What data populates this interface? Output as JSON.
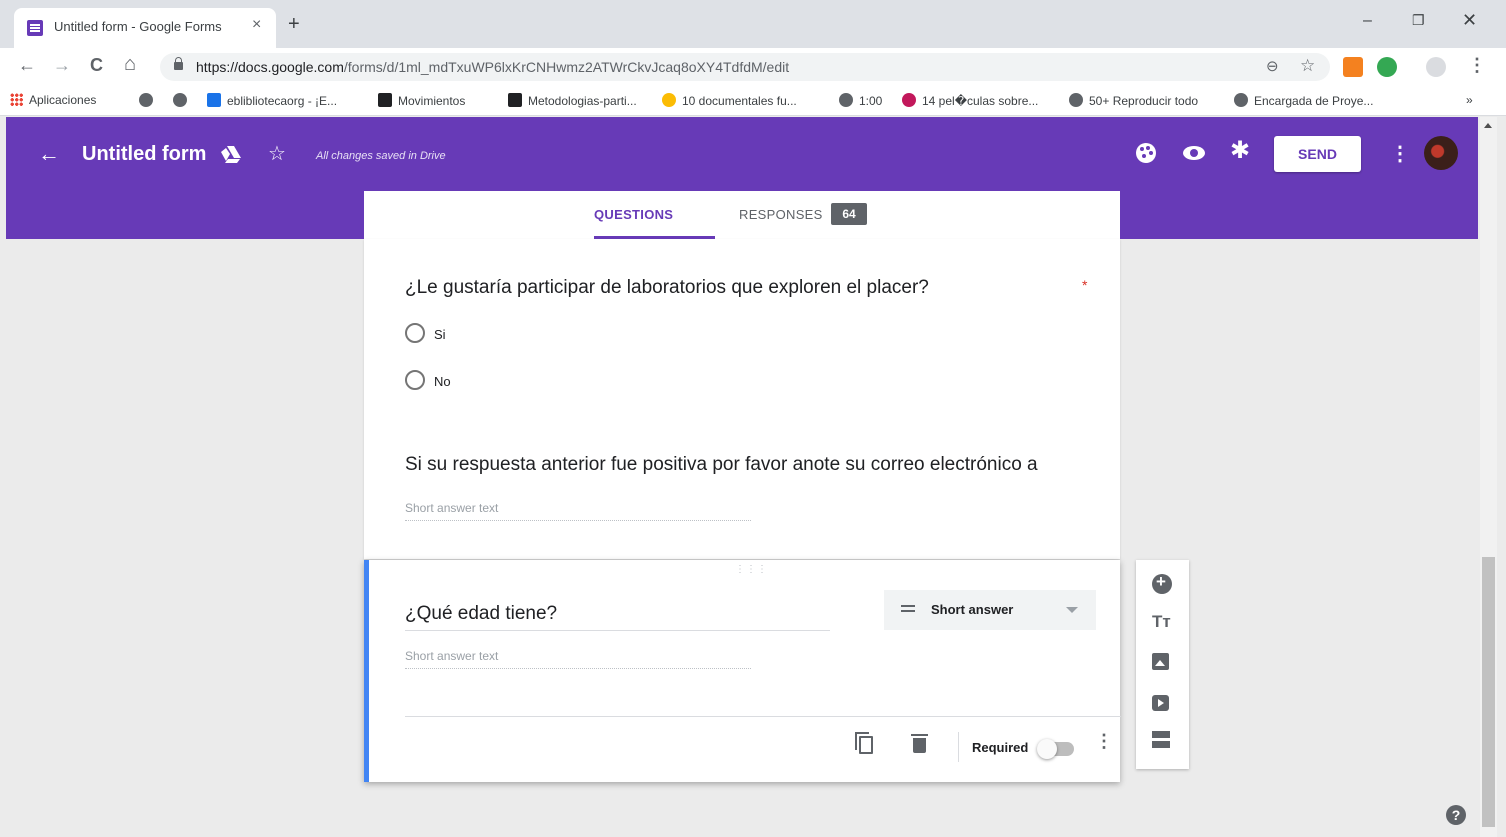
{
  "browser": {
    "tab_title": "Untitled form - Google Forms",
    "tab_close": "×",
    "new_tab": "+",
    "window_minimize": "–",
    "window_maximize": "❐",
    "window_close": "✕",
    "nav_back": "←",
    "nav_forward": "→",
    "nav_reload": "C",
    "nav_home": "⌂",
    "url_host": "https://docs.google.com",
    "url_path": "/forms/d/1ml_mdTxuWP6lxKrCNHwmz2ATWrCkvJcaq8oXY4TdfdM/edit",
    "menu": "⋮"
  },
  "bookmarks": [
    {
      "label": "Aplicaciones"
    },
    {
      "label": ""
    },
    {
      "label": ""
    },
    {
      "label": "eblibliotecaorg - ¡E..."
    },
    {
      "label": "Movimientos"
    },
    {
      "label": "Metodologias-parti..."
    },
    {
      "label": "10 documentales fu..."
    },
    {
      "label": "1:00"
    },
    {
      "label": "14 pel�culas sobre..."
    },
    {
      "label": "50+ Reproducir todo"
    },
    {
      "label": "Encargada de Proye..."
    }
  ],
  "bookmarks_overflow": "»",
  "header": {
    "back": "←",
    "title": "Untitled form",
    "star": "☆",
    "saved_status": "All changes saved in Drive",
    "gear": "✱",
    "send_label": "SEND",
    "more": "⋮"
  },
  "tabs": {
    "questions": "QUESTIONS",
    "responses": "RESPONSES",
    "responses_count": "64"
  },
  "questions": [
    {
      "title": "¿Le gustaría participar de laboratorios que exploren el placer?",
      "required_mark": "*",
      "options": [
        "Si",
        "No"
      ]
    },
    {
      "title": "Si su respuesta anterior fue positiva por favor anote su correo electrónico a",
      "placeholder": "Short answer text"
    },
    {
      "title": "¿Qué edad tiene?",
      "placeholder": "Short answer text",
      "type": "Short answer",
      "required_label": "Required",
      "required": false
    }
  ],
  "active_card": {
    "drag_handle": "⋮⋮⋮",
    "more": "⋮"
  },
  "side_toolbar": {
    "title_text": "Tт"
  },
  "help": "?",
  "colors": {
    "brand": "#673ab7",
    "active_card_border": "#4285f4",
    "required_star": "#d93025"
  }
}
